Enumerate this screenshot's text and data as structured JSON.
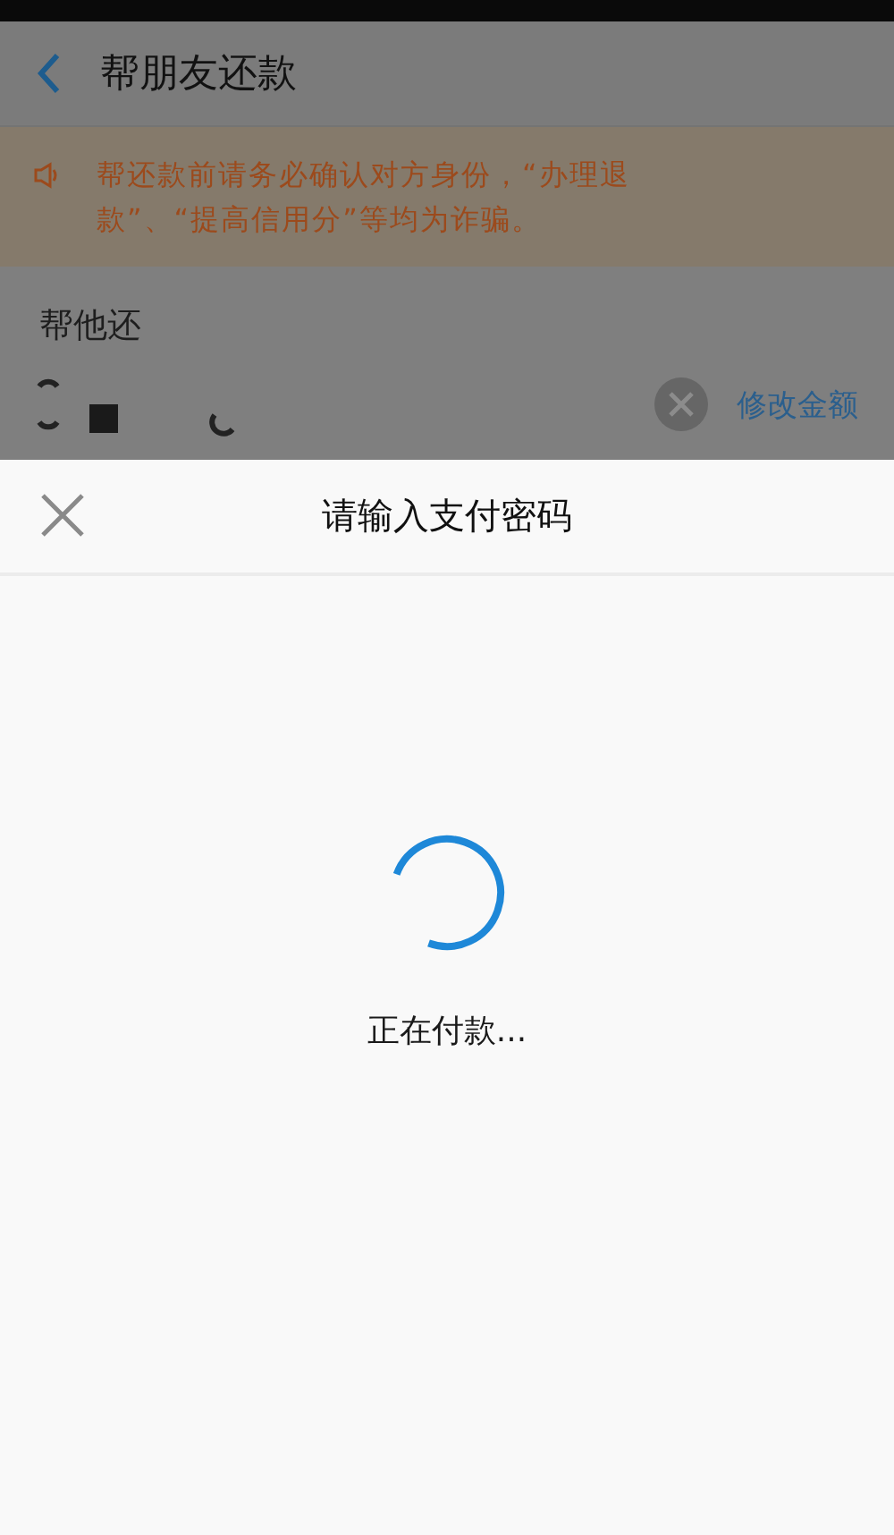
{
  "header": {
    "title": "帮朋友还款"
  },
  "notice": {
    "text": "帮还款前请务必确认对方身份，“办理退款”、“提高信用分”等均为诈骗。"
  },
  "repay": {
    "label": "帮他还",
    "edit_link": "修改金额"
  },
  "sheet": {
    "title": "请输入支付密码",
    "status": "正在付款..."
  }
}
